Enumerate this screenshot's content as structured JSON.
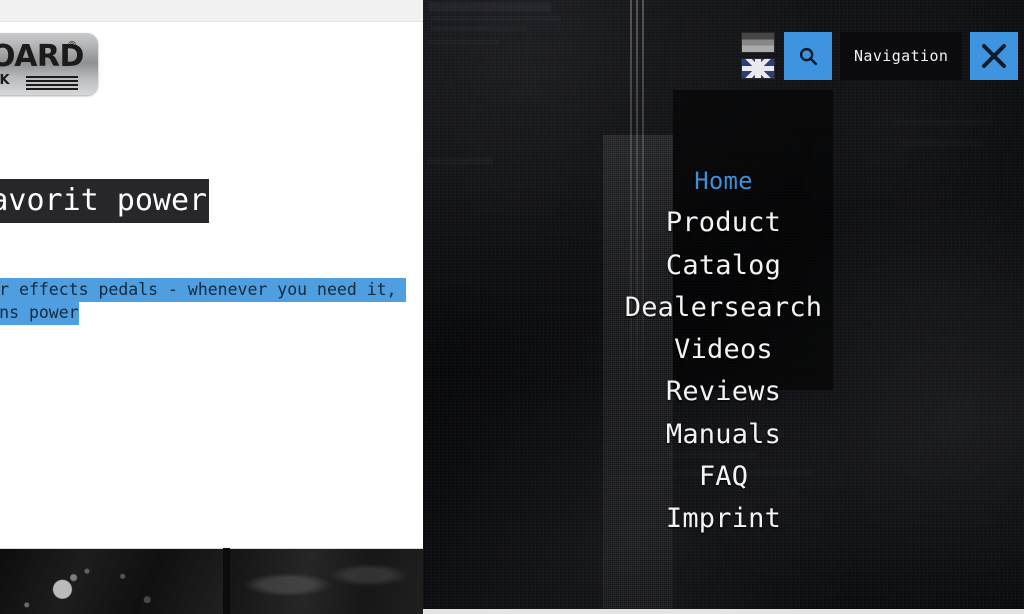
{
  "site": {
    "logo": {
      "word": "OARD",
      "registered": "®",
      "sub": "CK"
    },
    "headline": "ON's favorit power\ny!",
    "paragraph": "power for your effects pedals - whenever you need it, free from mains power\num!"
  },
  "controls": {
    "lang_de": "german-flag-icon",
    "lang_en": "uk-flag-icon",
    "search_icon": "search-icon",
    "nav_label": "Navigation",
    "close_icon": "close-icon"
  },
  "menu": {
    "items": [
      {
        "label": "Home",
        "active": true
      },
      {
        "label": "Product",
        "active": false
      },
      {
        "label": "Catalog",
        "active": false
      },
      {
        "label": "Dealersearch",
        "active": false
      },
      {
        "label": "Videos",
        "active": false
      },
      {
        "label": "Reviews",
        "active": false
      },
      {
        "label": "Manuals",
        "active": false
      },
      {
        "label": "FAQ",
        "active": false
      },
      {
        "label": "Imprint",
        "active": false
      }
    ]
  },
  "colors": {
    "accent_blue": "#3e94df",
    "active_link_blue": "#3d8fd8",
    "selection_blue": "#4f9ee0",
    "headline_bg": "#26262b",
    "overlay_bg": "#0a0b0e",
    "page_bg": "#ffffff"
  }
}
